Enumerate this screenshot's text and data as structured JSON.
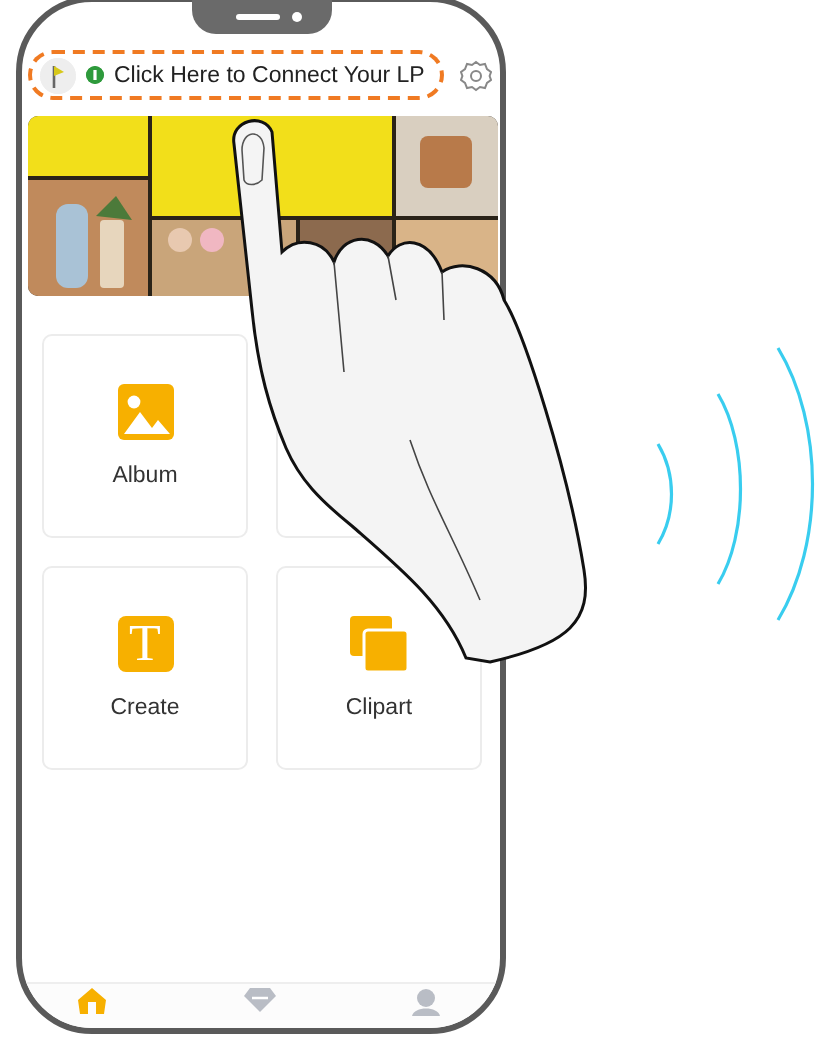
{
  "header": {
    "connect_label": "Click Here to Connect Your LP"
  },
  "tiles": [
    {
      "kind": "album",
      "label": "Album"
    },
    {
      "kind": "covered"
    },
    {
      "kind": "create",
      "label": "Create",
      "icon_text": "T"
    },
    {
      "kind": "clipart",
      "label": "Clipart"
    }
  ],
  "tab_bar": [
    {
      "kind": "home",
      "selected": true
    },
    {
      "kind": "gem",
      "selected": false
    },
    {
      "kind": "profile",
      "selected": false
    }
  ]
}
